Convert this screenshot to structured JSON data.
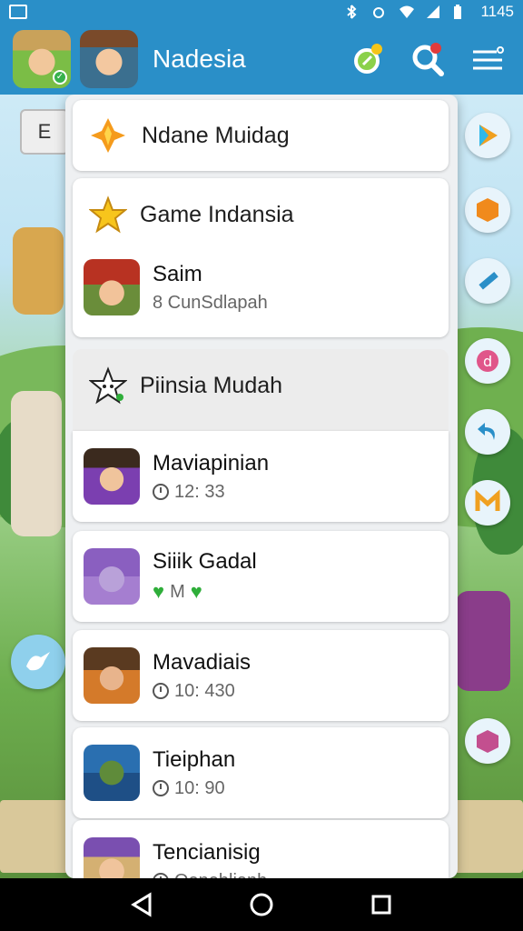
{
  "status_bar": {
    "time": "1145"
  },
  "app_bar": {
    "title": "Nadesia"
  },
  "scene": {
    "chip_text": "E"
  },
  "panel": {
    "header_card": {
      "title": "Ndane Muidag"
    },
    "section_1": {
      "title": "Game Indansia",
      "items": [
        {
          "title": "Saim",
          "subtitle": "8 CunSdlapah"
        }
      ]
    },
    "section_2": {
      "title": "Piinsia Mudah",
      "items": [
        {
          "title": "Maviapinian",
          "meta": "12: 33",
          "meta_type": "clock"
        },
        {
          "title": "Siiik Gadal",
          "meta": "M",
          "meta_type": "hearts"
        },
        {
          "title": "Mavadiais",
          "meta": "10: 430",
          "meta_type": "clock"
        },
        {
          "title": "Tieiphan",
          "meta": "10: 90",
          "meta_type": "clock"
        },
        {
          "title": "Tencianisig",
          "meta": "Oeneblianh",
          "meta_type": "clock"
        }
      ]
    }
  },
  "colors": {
    "app_bar": "#2a8fc8",
    "panel_bg": "#eef0f2",
    "heart_green": "#2fae3a"
  },
  "icons": {
    "header_card": "sparkle-diamond-icon",
    "section_1": "star-icon",
    "section_2": "star-face-icon"
  }
}
